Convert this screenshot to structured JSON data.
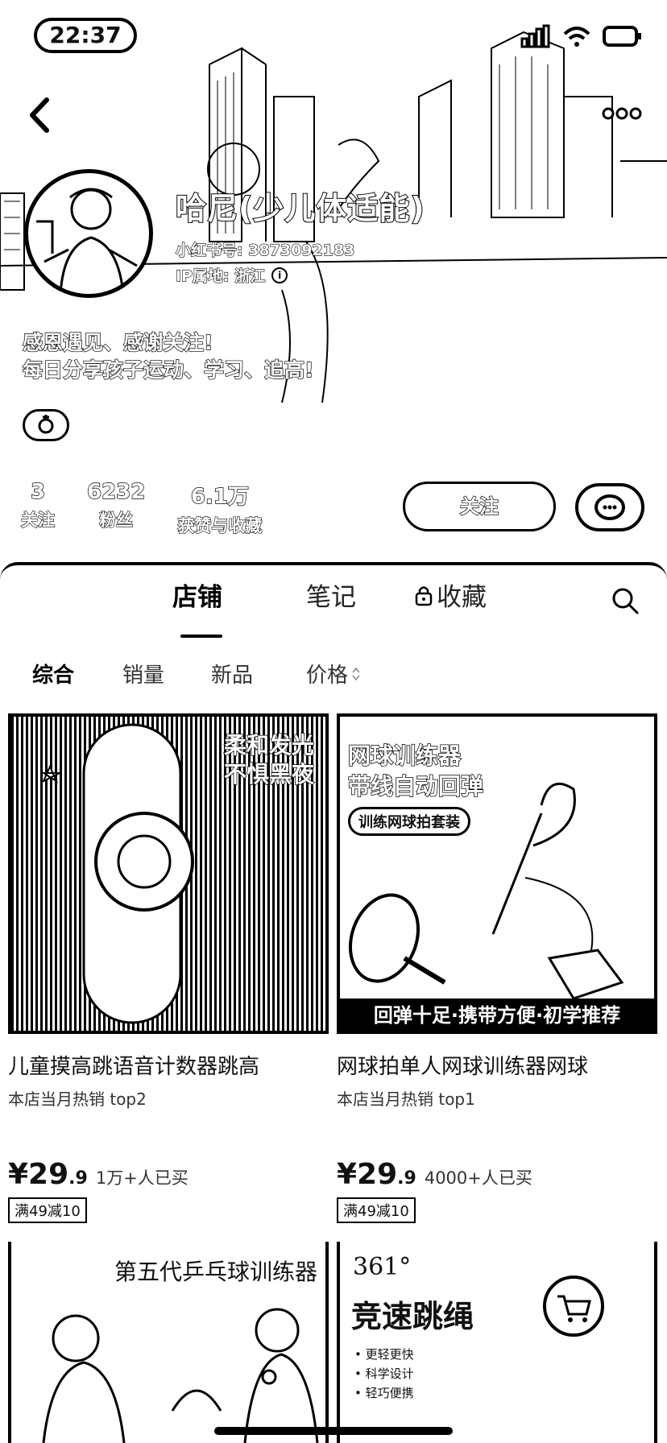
{
  "status_bar": {
    "time": "22:37"
  },
  "profile": {
    "name": "哈尼(少儿体适能)",
    "red_id": "小红书号: 3873092183",
    "ip_location": "IP属地: 浙江",
    "bio_line1": "感恩遇见、感谢关注!",
    "bio_line2": "每日分享孩子运动、学习、追高!",
    "stats": [
      {
        "num": "3",
        "label": "关注"
      },
      {
        "num": "6232",
        "label": "粉丝"
      },
      {
        "num": "6.1万",
        "label": "获赞与收藏"
      }
    ],
    "follow_label": "关注"
  },
  "tabs": [
    {
      "label": "店铺",
      "active": true
    },
    {
      "label": "笔记",
      "active": false
    },
    {
      "label": "收藏",
      "active": false,
      "icon": "lock-icon"
    }
  ],
  "sort": [
    {
      "label": "综合",
      "active": true
    },
    {
      "label": "销量",
      "active": false
    },
    {
      "label": "新品",
      "active": false
    },
    {
      "label": "价格",
      "active": false,
      "icon": "sort-arrows-icon"
    }
  ],
  "products": [
    {
      "title": "儿童摸高跳语音计数器跳高",
      "subtitle": "本店当月热销 top2",
      "price_int": "¥29",
      "price_dec": ".9",
      "sold": "1万+人已买",
      "coupon": "满49减10",
      "img_text1": "柔和发光",
      "img_text2": "不惧黑夜"
    },
    {
      "title": "网球拍单人网球训练器网球",
      "subtitle": "本店当月热销 top1",
      "price_int": "¥29",
      "price_dec": ".9",
      "sold": "4000+人已买",
      "coupon": "满49减10",
      "img_text1": "网球训练器",
      "img_text2": "带线自动回弹",
      "img_tag": "训练网球拍套装",
      "img_footer": "回弹十足·携带方便·初学推荐"
    }
  ],
  "partial_products": [
    {
      "img_title": "第五代乒乓球训练器"
    },
    {
      "img_brand": "361°",
      "img_title": "竞速跳绳",
      "bullets": [
        "更轻更快",
        "科学设计",
        "轻巧便携"
      ]
    }
  ]
}
